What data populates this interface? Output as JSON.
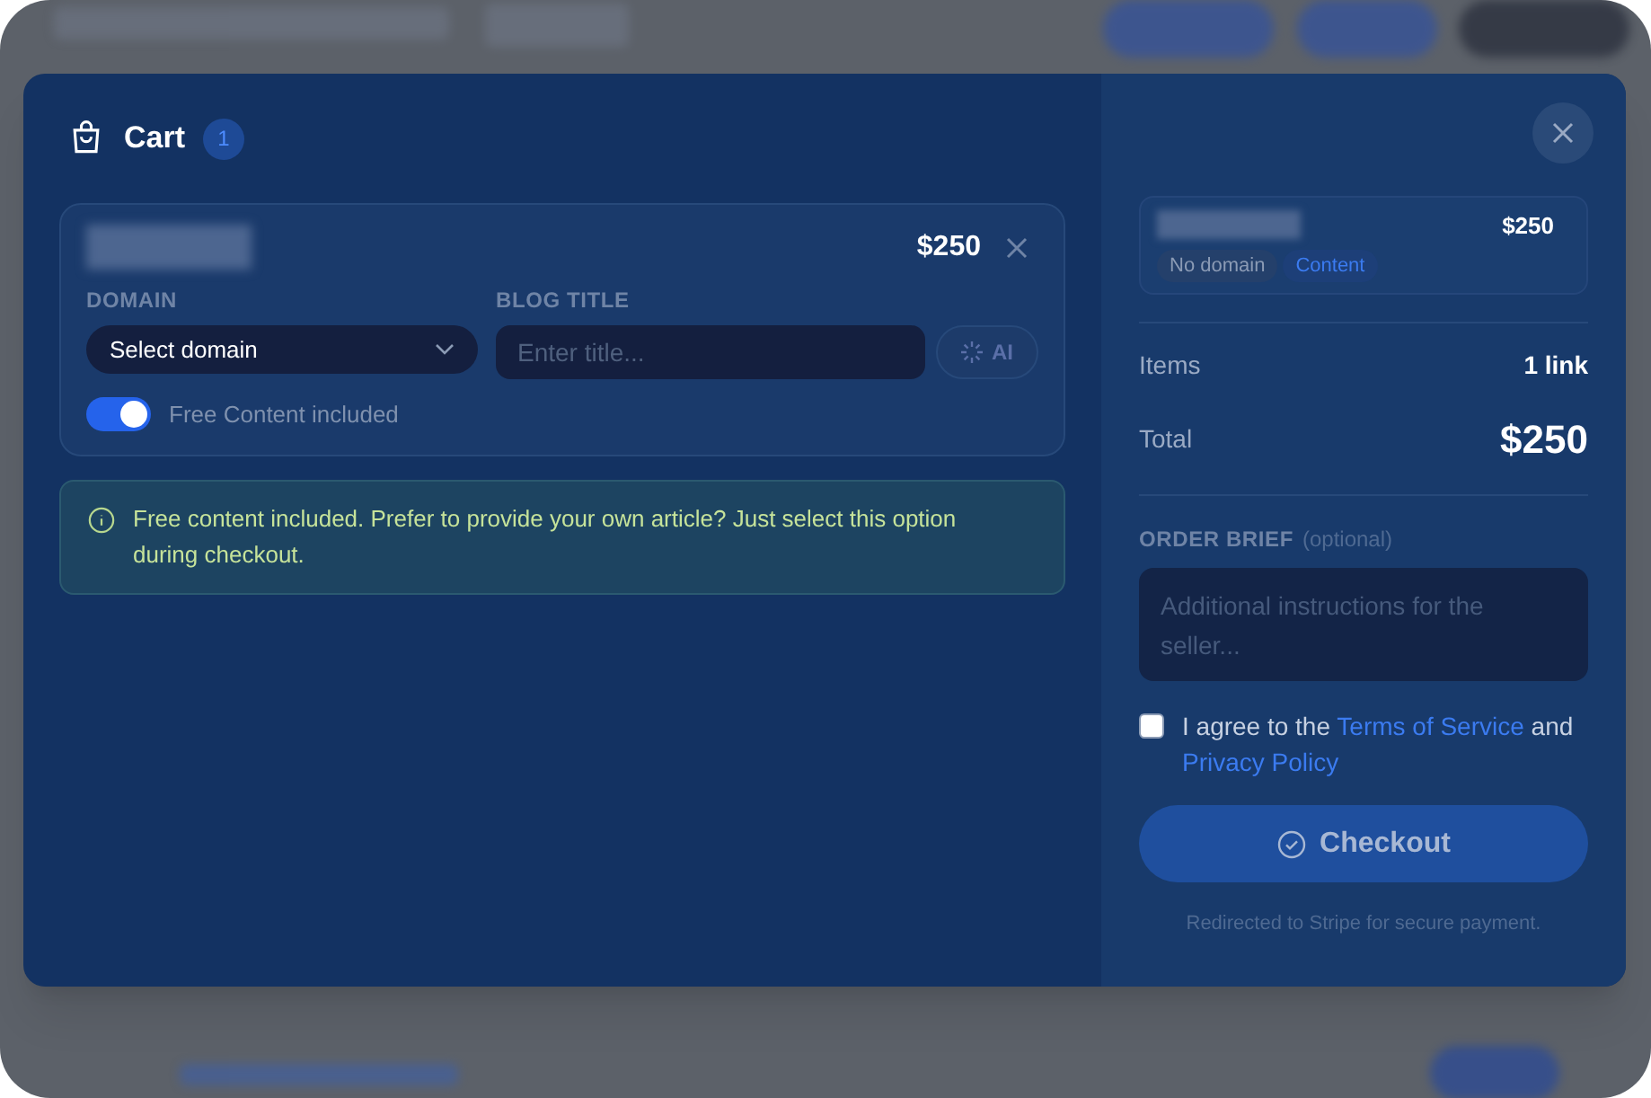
{
  "modal": {
    "title": "Cart",
    "count": "1"
  },
  "cart_item": {
    "price": "$250",
    "domain_label": "DOMAIN",
    "domain_select": "Select domain",
    "blog_title_label": "BLOG TITLE",
    "blog_title_placeholder": "Enter title...",
    "ai_button": "AI",
    "ai_disabled": true,
    "toggle": {
      "label": "Free Content included",
      "on": true
    }
  },
  "notice": "Free content included. Prefer to provide your own article? Just select this option during checkout.",
  "summary": {
    "item": {
      "price": "$250",
      "tags": [
        {
          "label": "No domain",
          "kind": "neutral"
        },
        {
          "label": "Content",
          "kind": "accent"
        }
      ]
    },
    "rows": [
      {
        "label": "Items",
        "value": "1 link",
        "kind": "count"
      },
      {
        "label": "Total",
        "value": "$250",
        "kind": "total"
      }
    ],
    "brief_label": "ORDER BRIEF",
    "brief_hint": "(optional)",
    "brief_placeholder": "Additional instructions for the seller...",
    "agree": {
      "checked": false,
      "prefix": "I agree to the",
      "terms": "Terms of Service",
      "middle": "and",
      "privacy": "Privacy Policy"
    },
    "checkout": {
      "label": "Checkout",
      "disabled": true
    },
    "footnote": "Redirected to Stripe for secure payment."
  }
}
